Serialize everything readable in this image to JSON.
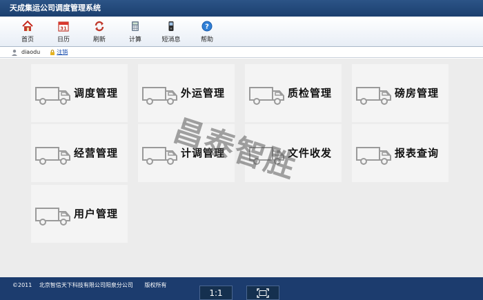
{
  "window": {
    "title": "天成集运公司调度管理系统"
  },
  "toolbar": {
    "items": [
      {
        "label": "首页",
        "icon": "home-icon"
      },
      {
        "label": "日历",
        "icon": "calendar-icon",
        "calendar_day": "31"
      },
      {
        "label": "刷新",
        "icon": "refresh-icon"
      },
      {
        "label": "计算",
        "icon": "calculator-icon"
      },
      {
        "label": "短消息",
        "icon": "phone-icon"
      },
      {
        "label": "帮助",
        "icon": "help-icon"
      }
    ]
  },
  "userbar": {
    "username": "diaodu",
    "logout_label": "注销"
  },
  "modules": [
    {
      "label": "调度管理",
      "icon": "truck-icon"
    },
    {
      "label": "外运管理",
      "icon": "truck-icon"
    },
    {
      "label": "质检管理",
      "icon": "truck-icon"
    },
    {
      "label": "磅房管理",
      "icon": "truck-icon"
    },
    {
      "label": "经营管理",
      "icon": "truck-icon"
    },
    {
      "label": "计调管理",
      "icon": "truck-icon"
    },
    {
      "label": "文件收发",
      "icon": "truck-icon"
    },
    {
      "label": "报表查询",
      "icon": "truck-icon"
    },
    {
      "label": "用户管理",
      "icon": "truck-icon"
    }
  ],
  "watermark": "昌泰智胜",
  "footer": {
    "copyright": "©2011",
    "company": "北京智信天下科技有限公司阳泉分公司",
    "rights": "版权所有"
  },
  "viewer": {
    "zoom_label": "1:1",
    "fit_icon": "fit-screen-icon"
  },
  "colors": {
    "header": "#1c3c6e",
    "tile_bg": "#f4f4f4",
    "main_bg": "#ececec",
    "link": "#1a4fb0"
  }
}
